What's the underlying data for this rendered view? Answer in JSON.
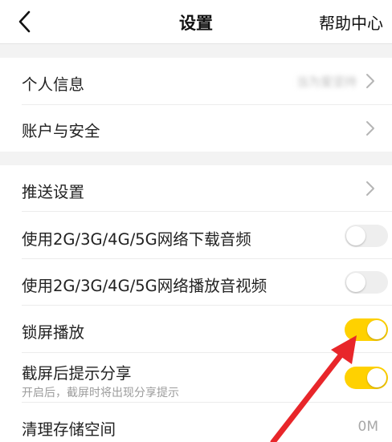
{
  "header": {
    "title": "设置",
    "help_label": "帮助中心"
  },
  "group1": {
    "personal_info": {
      "label": "个人信息",
      "value": "当为爱坚持"
    },
    "account_security": {
      "label": "账户与安全"
    }
  },
  "group2": {
    "push_settings": {
      "label": "推送设置"
    },
    "mobile_download": {
      "label": "使用2G/3G/4G/5G网络下载音频",
      "enabled": false
    },
    "mobile_play": {
      "label": "使用2G/3G/4G/5G网络播放音视频",
      "enabled": false
    },
    "lockscreen_play": {
      "label": "锁屏播放",
      "enabled": true
    },
    "screenshot_share": {
      "label": "截屏后提示分享",
      "hint": "开启后，截屏时将出现分享提示",
      "enabled": true
    },
    "clear_storage": {
      "label": "清理存储空间",
      "value": "0M"
    }
  },
  "colors": {
    "accent": "#ffd100",
    "annotation_arrow": "#e8262a",
    "section_gap": "#f3f3f3"
  }
}
